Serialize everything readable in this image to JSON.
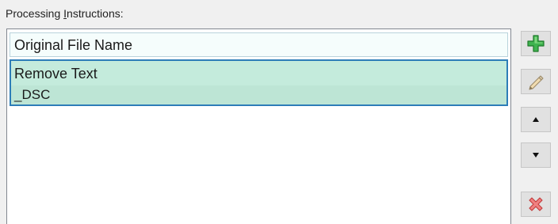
{
  "section": {
    "label_prefix": "Processing ",
    "label_mnemonic": "I",
    "label_suffix": "nstructions:"
  },
  "instructions": [
    {
      "title": "Original File Name",
      "selected": false
    },
    {
      "title": "Remove Text",
      "detail": "_DSC",
      "selected": true
    }
  ],
  "toolbar": {
    "add_icon": "plus-icon",
    "edit_icon": "pencil-icon",
    "up_icon": "arrow-up-icon",
    "down_icon": "arrow-down-icon",
    "remove_icon": "delete-x-icon"
  },
  "colors": {
    "selected_fill": "#c4ebdc",
    "selected_border": "#2d7db8",
    "add_icon": "#34a853",
    "remove_icon": "#e05a5a"
  }
}
